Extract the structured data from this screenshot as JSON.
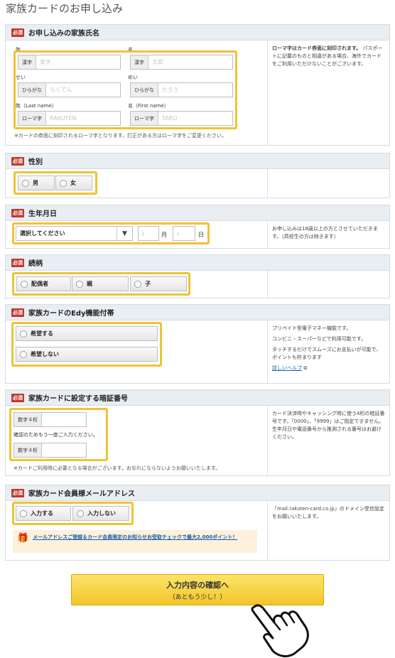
{
  "page_title": "家族カードのお申し込み",
  "required_badge": "必須",
  "name_section": {
    "title": "お申し込みの家族氏名",
    "last_name_label": "姓",
    "first_name_label": "名",
    "kana_last_label": "せい",
    "kana_first_label": "めい",
    "roman_last_label": "姓（Last name）",
    "roman_first_label": "名（First name）",
    "kanji_prefix": "漢字",
    "hiragana_prefix": "ひらがな",
    "roman_prefix": "ローマ字",
    "last_kanji_placeholder": "楽天",
    "first_kanji_placeholder": "太郎",
    "last_kana_placeholder": "らくてん",
    "first_kana_placeholder": "たろう",
    "last_roman_placeholder": "RAKUTEN",
    "first_roman_placeholder": "TARO",
    "note": "※カードの券面に刻印されるローマ字となります。訂正がある方はローマ字をご変更ください。",
    "side_title": "ローマ字はカード券面に刻印されます。",
    "side_text": "パスポートに記載のものと相違がある場合、海外でカードをご利用いただけないことがございます。"
  },
  "gender_section": {
    "title": "性別",
    "options": [
      "男",
      "女"
    ]
  },
  "birth_section": {
    "title": "生年月日",
    "year_select": "選択してください",
    "month_label": "月",
    "day_label": "日",
    "month_placeholder": "1",
    "day_placeholder": "1",
    "side_text": "お申し込みは18歳以上の方とさせていただきます。（高校生の方は除きます）"
  },
  "relation_section": {
    "title": "続柄",
    "options": [
      "配偶者",
      "親",
      "子"
    ]
  },
  "edy_section": {
    "title": "家族カードのEdy機能付帯",
    "options": [
      "希望する",
      "希望しない"
    ],
    "side_lines": [
      "プリペイド型電子マネー機能です。",
      "コンビニ・スーパーなどで利用可能です。",
      "タッチするだけでスムーズにお支払いが可能で、ポイントも貯まります"
    ],
    "help_link": "詳しいヘルプ"
  },
  "pin_section": {
    "title": "家族カードに設定する暗証番号",
    "prefix": "数字４桁",
    "confirm_label": "確認のためもう一度ご入力ください。",
    "note": "※カードご利用時に必要となる場合がございます。お忘れにならないようお願いいたします。",
    "side_text": "カード決済時やキャッシング時に使う4桁の暗証番号です。「0000」、「9999」はご指定できません。生年月日や電話番号から推測される番号はお避けください。"
  },
  "mail_section": {
    "title": "家族カード会員様メールアドレス",
    "options": [
      "入力する",
      "入力しない"
    ],
    "promo_text": "メールアドレスご登録＆カード会員限定のお知らせお受取チェックで最大2,000ポイント！",
    "side_text": "「mail.rakuten-card.co.jp」のドメイン受信設定をお願いいたします。"
  },
  "confirm_button": {
    "line1": "入力内容の確認へ",
    "line2": "（あともう少し！）"
  },
  "colors": {
    "highlight": "#f1c232",
    "required": "#c0392b",
    "button": "#f3c52a",
    "link": "#1a5fa8"
  }
}
